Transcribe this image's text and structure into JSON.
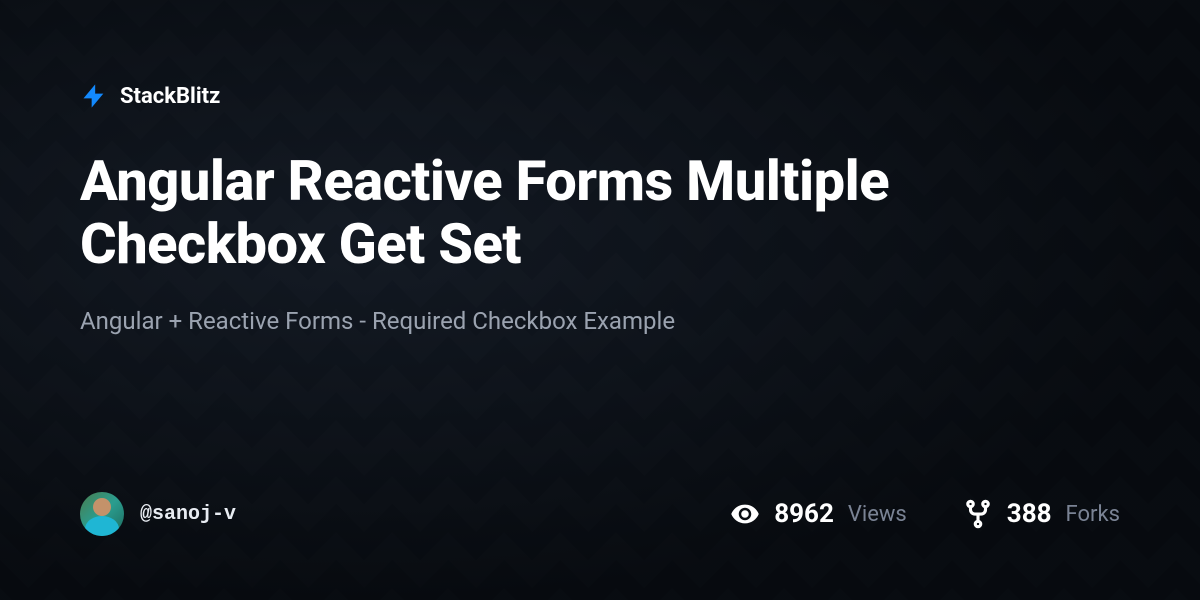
{
  "brand": {
    "name": "StackBlitz"
  },
  "project": {
    "title": "Angular Reactive Forms Multiple Checkbox Get Set",
    "description": "Angular + Reactive Forms - Required Checkbox Example"
  },
  "author": {
    "username": "@sanoj-v"
  },
  "stats": {
    "views": {
      "count": "8962",
      "label": "Views"
    },
    "forks": {
      "count": "388",
      "label": "Forks"
    }
  }
}
